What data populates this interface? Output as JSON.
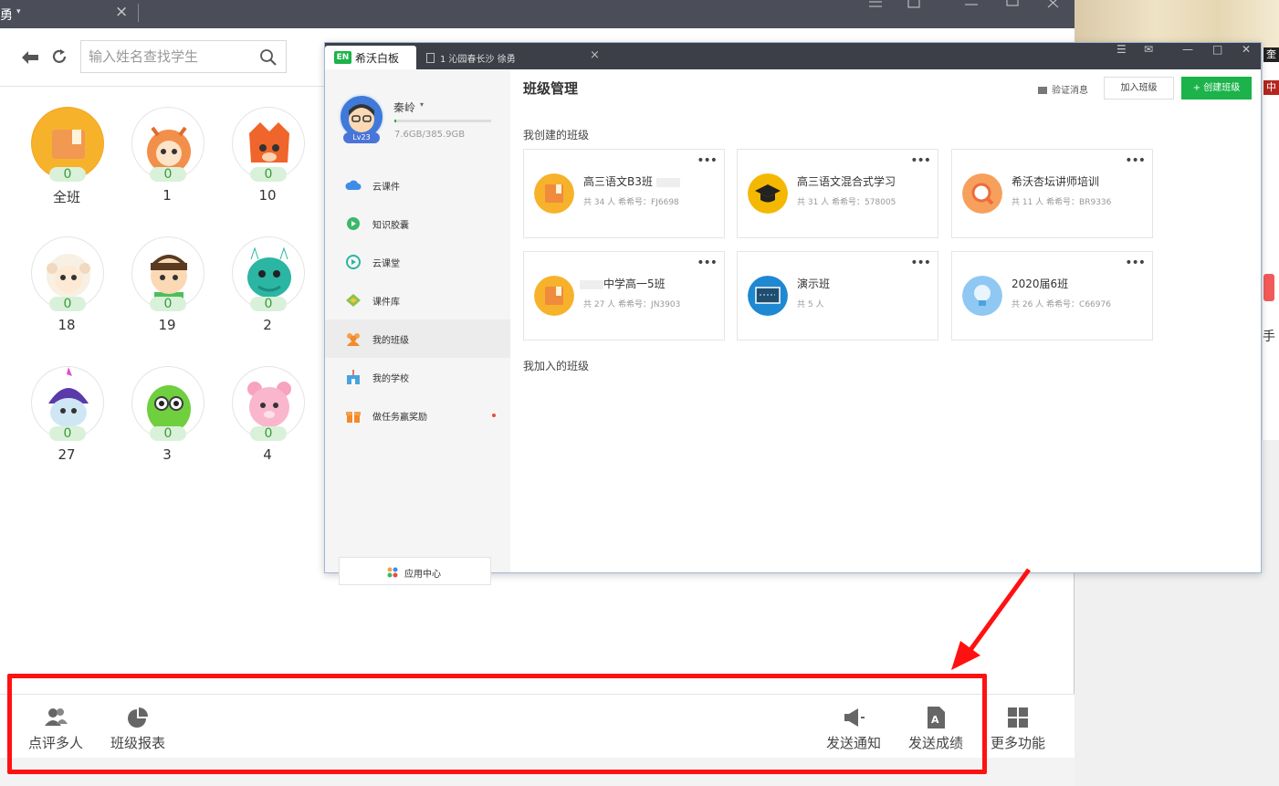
{
  "background_window": {
    "tab_title": "勇",
    "search_placeholder": "输入姓名查找学生",
    "students": [
      {
        "name": "全班",
        "score": "0"
      },
      {
        "name": "1",
        "score": "0"
      },
      {
        "name": "10",
        "score": "0"
      },
      {
        "name": "18",
        "score": "0"
      },
      {
        "name": "19",
        "score": "0"
      },
      {
        "name": "2",
        "score": "0"
      },
      {
        "name": "27",
        "score": "0"
      },
      {
        "name": "3",
        "score": "0"
      },
      {
        "name": "4",
        "score": "0"
      }
    ],
    "bottom_bar": {
      "review_multiple": "点评多人",
      "class_report": "班级报表",
      "send_notice": "发送通知",
      "send_grades": "发送成绩",
      "more_features": "更多功能"
    }
  },
  "right_strip": {
    "tag1": "奎",
    "tag2": "中",
    "hand": "手"
  },
  "foreground_window": {
    "app_name": "希沃白板",
    "logo_text": "EN",
    "doc_tab": "1 沁园春长沙 徐勇",
    "user": {
      "name": "秦岭",
      "level": "Lv23",
      "storage": "7.6GB/385.9GB",
      "storage_used_fraction": 0.02
    },
    "nav": [
      {
        "label": "云课件",
        "icon": "cloud-icon"
      },
      {
        "label": "知识胶囊",
        "icon": "capsule-icon"
      },
      {
        "label": "云课堂",
        "icon": "play-icon"
      },
      {
        "label": "课件库",
        "icon": "diamond-icon"
      },
      {
        "label": "我的班级",
        "icon": "group-icon"
      },
      {
        "label": "我的学校",
        "icon": "school-icon"
      },
      {
        "label": "做任务赢奖励",
        "icon": "gift-icon"
      }
    ],
    "app_center": "应用中心",
    "page_title": "班级管理",
    "verify_messages": "验证消息",
    "join_class": "加入班级",
    "create_class": "+ 创建班级",
    "created_section": "我创建的班级",
    "joined_section": "我加入的班级",
    "classes": [
      {
        "name": "高三语文B3班",
        "meta": "共 34 人  希希号：FJ6698"
      },
      {
        "name": "高三语文混合式学习",
        "meta": "共 31 人  希希号：578005"
      },
      {
        "name": "希沃杏坛讲师培训",
        "meta": "共 11 人  希希号：BR9336"
      },
      {
        "name": "中学高一5班",
        "meta": "共 27 人  希希号：JN3903"
      },
      {
        "name": "演示班",
        "meta": "共 5 人"
      },
      {
        "name": "2020届6班",
        "meta": "共 26 人  希希号：C66976"
      }
    ]
  }
}
